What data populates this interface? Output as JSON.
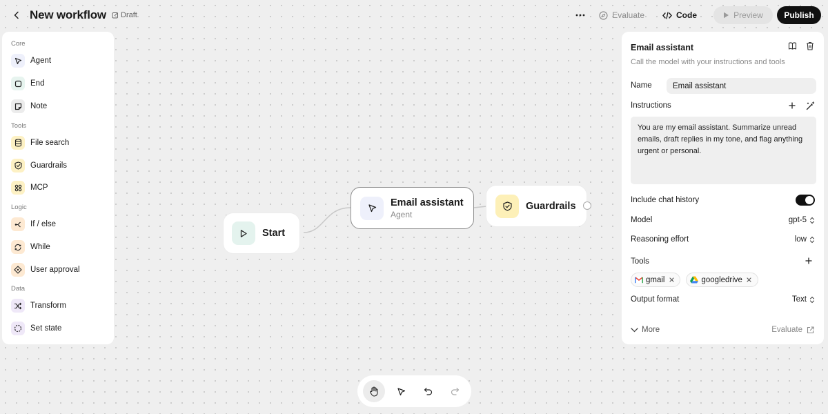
{
  "header": {
    "title": "New workflow",
    "status": "Draft",
    "evaluate_label": "Evaluate",
    "code_label": "Code",
    "preview_label": "Preview",
    "publish_label": "Publish"
  },
  "palette": {
    "sections": [
      {
        "label": "Core",
        "items": [
          {
            "label": "Agent",
            "icon": "cursor-icon",
            "color": "#eef0fb"
          },
          {
            "label": "End",
            "icon": "stop-icon",
            "color": "#e7f4ef"
          },
          {
            "label": "Note",
            "icon": "note-icon",
            "color": "#ececec"
          }
        ]
      },
      {
        "label": "Tools",
        "items": [
          {
            "label": "File search",
            "icon": "database-icon",
            "color": "#fdf1c4"
          },
          {
            "label": "Guardrails",
            "icon": "shield-icon",
            "color": "#fdf1c4"
          },
          {
            "label": "MCP",
            "icon": "grid-icon",
            "color": "#fdf1c4"
          }
        ]
      },
      {
        "label": "Logic",
        "items": [
          {
            "label": "If / else",
            "icon": "branch-icon",
            "color": "#fde9d2"
          },
          {
            "label": "While",
            "icon": "loop-icon",
            "color": "#fde9d2"
          },
          {
            "label": "User approval",
            "icon": "approval-icon",
            "color": "#fde9d2"
          }
        ]
      },
      {
        "label": "Data",
        "items": [
          {
            "label": "Transform",
            "icon": "shuffle-icon",
            "color": "#efe8f8"
          },
          {
            "label": "Set state",
            "icon": "dashed-circle-icon",
            "color": "#efe8f8"
          }
        ]
      }
    ]
  },
  "canvas": {
    "nodes": {
      "start": {
        "title": "Start",
        "color": "#e4f3ee"
      },
      "agent": {
        "title": "Email assistant",
        "subtitle": "Agent",
        "color": "#eef0fb"
      },
      "guardrails": {
        "title": "Guardrails",
        "color": "#fdf0b8"
      }
    }
  },
  "panel": {
    "title": "Email assistant",
    "subtitle": "Call the model with your instructions and tools",
    "name_label": "Name",
    "name_value": "Email assistant",
    "instructions_label": "Instructions",
    "instructions_value": "You are my email assistant. Summarize unread emails, draft replies in my tone, and flag anything urgent or personal.",
    "chat_history_label": "Include chat history",
    "chat_history_enabled": true,
    "model_label": "Model",
    "model_value": "gpt-5",
    "reasoning_label": "Reasoning effort",
    "reasoning_value": "low",
    "tools_label": "Tools",
    "tools": [
      {
        "label": "gmail",
        "icon": "gmail-icon"
      },
      {
        "label": "googledrive",
        "icon": "google-drive-icon"
      }
    ],
    "output_label": "Output format",
    "output_value": "Text",
    "more_label": "More",
    "evaluate_label": "Evaluate"
  },
  "colors": {
    "accent_dark": "#111111",
    "canvas_bg": "#efefef"
  }
}
